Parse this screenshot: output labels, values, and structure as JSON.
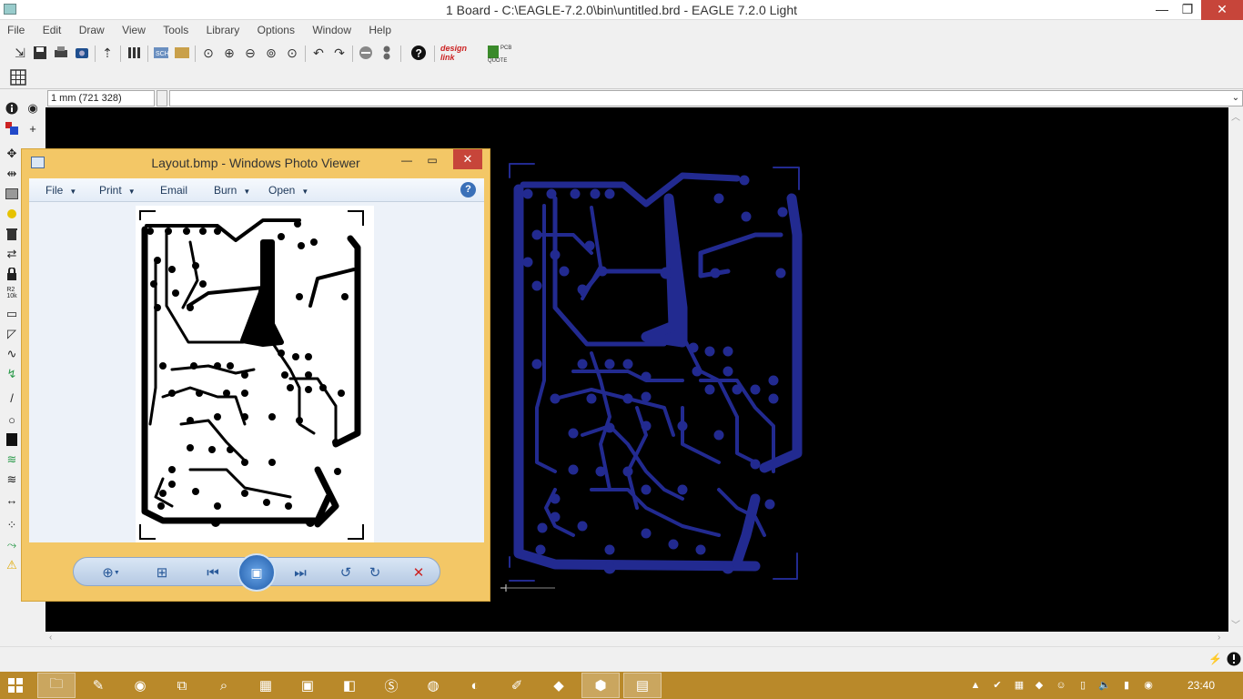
{
  "window": {
    "title": "1 Board - C:\\EAGLE-7.2.0\\bin\\untitled.brd - EAGLE 7.2.0 Light",
    "minimize": "—",
    "restore": "❐",
    "close": "✕"
  },
  "menu": [
    "File",
    "Edit",
    "Draw",
    "View",
    "Tools",
    "Library",
    "Options",
    "Window",
    "Help"
  ],
  "coord": {
    "readout": "1 mm (721 328)"
  },
  "toolbar": {
    "brand_designlink": "design link",
    "brand_pcbquote": "PCB QUOTE"
  },
  "photo_viewer": {
    "title": "Layout.bmp - Windows Photo Viewer",
    "menu": {
      "file": "File",
      "print": "Print",
      "email": "Email",
      "burn": "Burn",
      "open": "Open"
    },
    "help": "?"
  },
  "taskbar": {
    "clock": "23:40"
  },
  "colors": {
    "trace_blue": "#222a90",
    "taskbar": "#b9892a",
    "viewer_frame": "#f3c766"
  }
}
